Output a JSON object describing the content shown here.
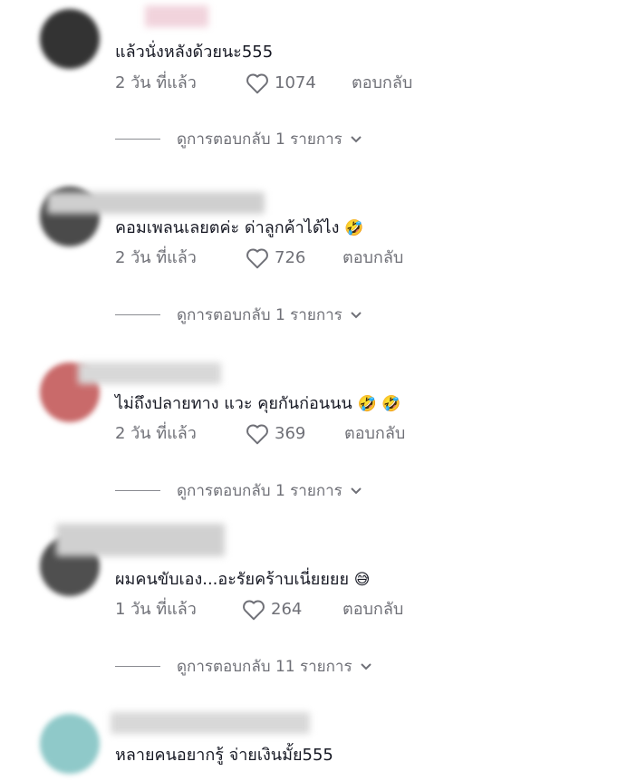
{
  "comments": [
    {
      "text": "แล้วนั่งหลังด้วยนะ555",
      "time": "2 วัน ที่แล้ว",
      "likes": "1074",
      "reply": "ตอบกลับ",
      "view_replies": "ดูการตอบกลับ 1 รายการ",
      "avatar_color": "#3a3a3a"
    },
    {
      "text": "คอมเพลนเลยตค่ะ ด่าลูกค้าได้ไง",
      "emoji": "🤣",
      "time": "2 วัน ที่แล้ว",
      "likes": "726",
      "reply": "ตอบกลับ",
      "view_replies": "ดูการตอบกลับ 1 รายการ",
      "avatar_color": "#4a4a4a"
    },
    {
      "text": "ไม่ถึงปลายทาง แวะ คุยกันก่อนนน",
      "emoji": "🤣 🤣",
      "time": "2 วัน ที่แล้ว",
      "likes": "369",
      "reply": "ตอบกลับ",
      "view_replies": "ดูการตอบกลับ 1 รายการ",
      "avatar_color": "#c96a6a"
    },
    {
      "text": "ผมคนขับเอง...อะรัยคร้าบเนี่ยยยย",
      "emoji": "😅",
      "time": "1 วัน ที่แล้ว",
      "likes": "264",
      "reply": "ตอบกลับ",
      "view_replies": "ดูการตอบกลับ 11 รายการ",
      "avatar_color": "#555555"
    },
    {
      "text": "หลายคนอยากรู้ จ่ายเงินมั้ย555",
      "avatar_color": "#8fc9c9"
    }
  ],
  "icons": {
    "like": "heart-outline-icon",
    "expand": "chevron-down-icon"
  }
}
